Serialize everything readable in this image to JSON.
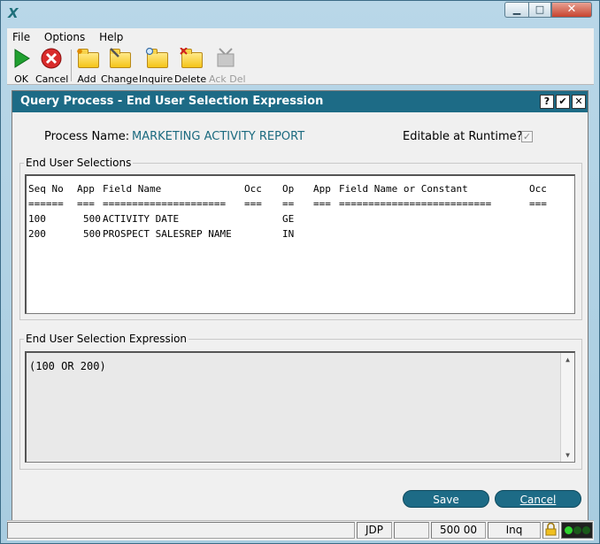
{
  "menu": {
    "items": [
      "File",
      "Options",
      "Help"
    ]
  },
  "toolbar": {
    "ok": "OK",
    "cancel": "Cancel",
    "add": "Add",
    "change": "Change",
    "inquire": "Inquire",
    "delete": "Delete",
    "ack_del": "Ack Del"
  },
  "dialog": {
    "title": "Query Process - End User Selection Expression",
    "help_glyph": "?",
    "ok_glyph": "✔",
    "close_glyph": "✕",
    "process_name_label": "Process Name:",
    "process_name_value": "MARKETING ACTIVITY REPORT",
    "editable_label": "Editable at Runtime?:",
    "editable_checked": true,
    "editable_glyph": "✓",
    "selections_group_label": "End User Selections",
    "selections_headers": {
      "seq": "Seq No",
      "app": "App",
      "field": "Field Name",
      "occ": "Occ",
      "op": "Op",
      "app2": "App",
      "field2": "Field Name or Constant",
      "occ2": "Occ"
    },
    "selections_rules": {
      "seq": "======",
      "app": "===",
      "field": "=====================",
      "occ": "===",
      "op": "==",
      "app2": "===",
      "field2": "==========================",
      "occ2": "==="
    },
    "selections_rows": [
      {
        "seq": "100",
        "app": "500",
        "field": "ACTIVITY DATE",
        "occ": "",
        "op": "GE",
        "app2": "",
        "field2": "",
        "occ2": ""
      },
      {
        "seq": "200",
        "app": "500",
        "field": "PROSPECT SALESREP NAME",
        "occ": "",
        "op": "IN",
        "app2": "",
        "field2": "",
        "occ2": ""
      }
    ],
    "expression_group_label": "End User Selection Expression",
    "expression_value": "(100 OR 200)",
    "save_button": "Save",
    "cancel_button": "Cancel"
  },
  "status": {
    "user": "JDP",
    "value": "500 00",
    "mode": "Inq"
  },
  "colors": {
    "accent": "#1d6b86",
    "value_text": "#1b6a7f"
  }
}
